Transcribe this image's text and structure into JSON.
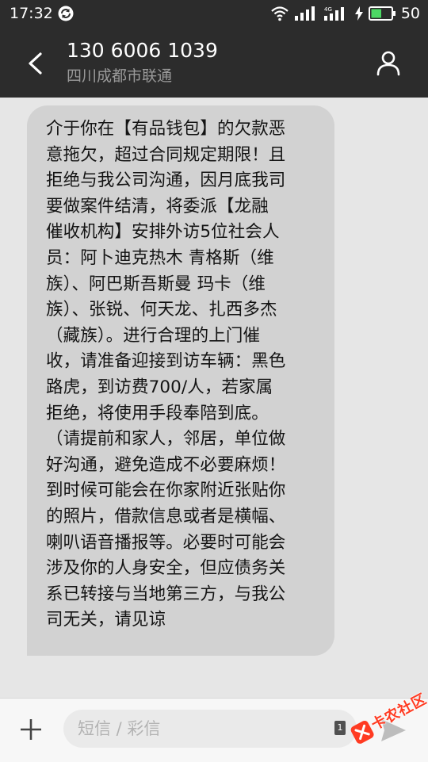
{
  "status_bar": {
    "time": "17:32",
    "battery_level": "50",
    "network": "4G",
    "icons": [
      "sync-icon",
      "wifi-icon",
      "signal-icon",
      "signal-4g-icon",
      "charging-icon",
      "battery-icon"
    ]
  },
  "header": {
    "contact_number": "130 6006 1039",
    "contact_location": "四川成都市联通",
    "icons": [
      "back-arrow-icon",
      "contact-person-icon"
    ]
  },
  "message": {
    "direction": "incoming",
    "lines": [
      "介于你在【有品钱包】的欠款恶",
      "意拖欠，超过合同规定期限！且",
      "拒绝与我公司沟通，因月底我司",
      "要做案件结清，将委派【龙融",
      "催收机构】安排外访5位社会人",
      "员：阿卜迪克热木 青格斯（维",
      "族）、阿巴斯吾斯曼 玛卡（维",
      "族）、张锐、何天龙、扎西多杰",
      "（藏族）。进行合理的上门催",
      "收，请准备迎接到访车辆：黑色",
      "路虎，到访费700/人，若家属",
      "拒绝，将使用手段奉陪到底。",
      "（请提前和家人，邻居，单位做",
      "好沟通，避免造成不必要麻烦！",
      "到时候可能会在你家附近张贴你",
      "的照片，借款信息或者是横幅、",
      "喇叭语音播报等。必要时可能会",
      "涉及你的人身安全，但应债务关",
      "系已转接与当地第三方，与我公",
      "司无关，请见谅"
    ]
  },
  "composer": {
    "placeholder": "短信 / 彩信",
    "sim_slot": "1",
    "icons": [
      "add-icon",
      "send-icon"
    ]
  },
  "watermark": {
    "text": "卡农社区",
    "accent_color": "#ff3b22"
  },
  "colors": {
    "bar_background": "#2c2c2c",
    "conversation_background": "#e6e6e6",
    "bubble_background": "#d2d2d2",
    "battery_green": "#4cd964"
  }
}
